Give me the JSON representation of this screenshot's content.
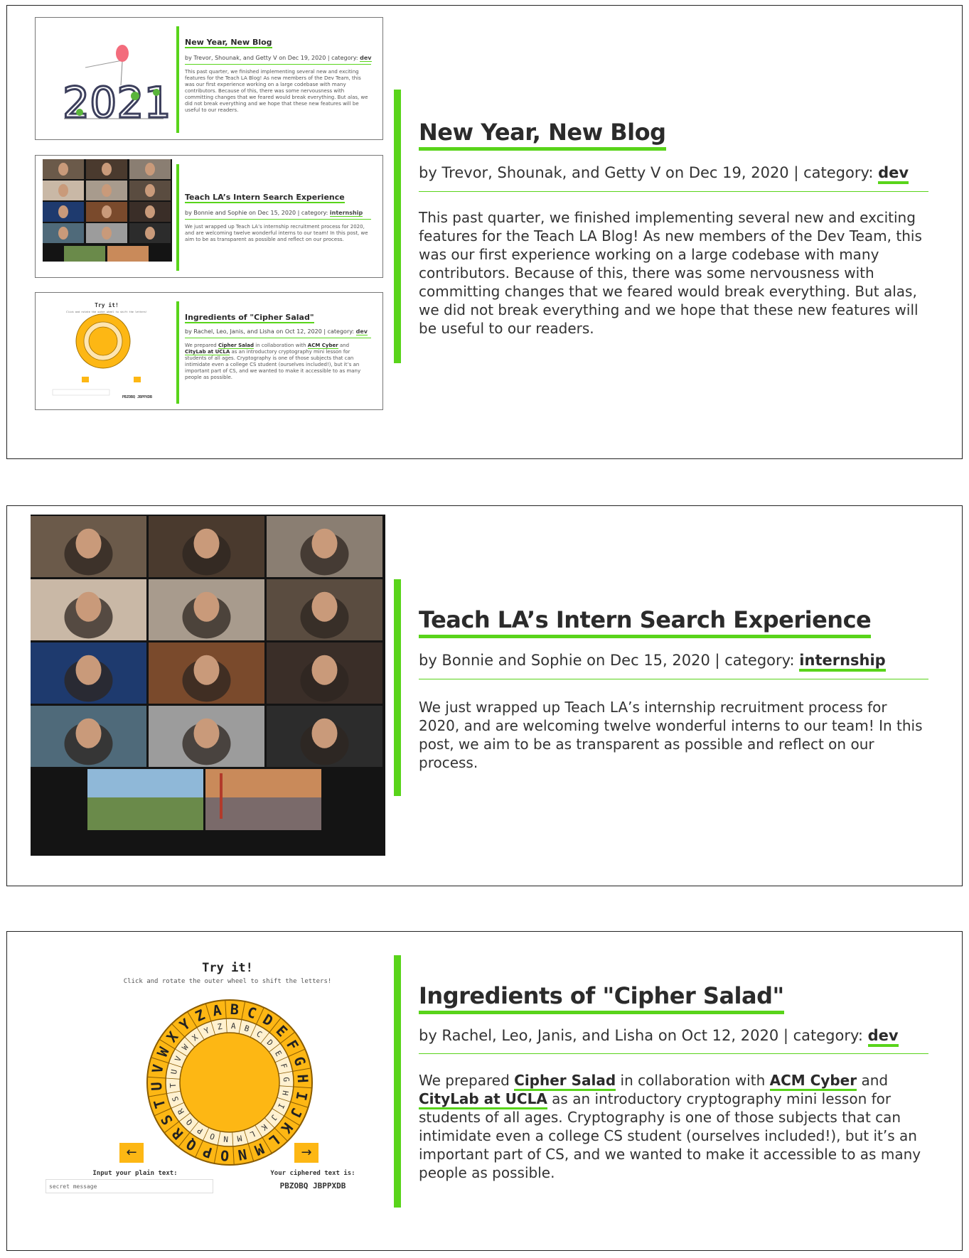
{
  "posts": [
    {
      "title": "New Year, New Blog",
      "byline_prefix": "by Trevor, Shounak, and Getty V on Dec 19, 2020 | category: ",
      "category": "dev",
      "body": "This past quarter, we finished implementing several new and exciting features for the Teach LA Blog! As new members of the Dev Team, this was our first experience working on a large codebase with many contributors. Because of this, there was some nervousness with committing changes that we feared would break everything. But alas, we did not break everything and we hope that these new features will be useful to our readers."
    },
    {
      "title": "Teach LA’s Intern Search Experience",
      "byline_prefix": "by Bonnie and Sophie on Dec 15, 2020 | category: ",
      "category": "internship",
      "body": "We just wrapped up Teach LA’s internship recruitment process for 2020, and are welcoming twelve wonderful interns to our team! In this post, we aim to be as transparent as possible and reflect on our process."
    },
    {
      "title": "Ingredients of \"Cipher Salad\"",
      "byline_prefix": "by Rachel, Leo, Janis, and Lisha on Oct 12, 2020 | category: ",
      "category": "dev",
      "body_parts": {
        "p1": "We prepared ",
        "link1": "Cipher Salad",
        "p2": " in collaboration with ",
        "link2": "ACM Cyber",
        "p3": " and ",
        "link3": "CityLab at UCLA",
        "p4": " as an introductory cryptography mini lesson for students of all ages. Cryptography is one of those subjects that can intimidate even a college CS student (ourselves included!), but it’s an important part of CS, and we wanted to make it accessible to as many people as possible."
      }
    }
  ],
  "thumbnails": {
    "year_image_text": "2021"
  },
  "cipher": {
    "heading": "Try it!",
    "instruction": "Click and rotate the outer wheel to shift the letters!",
    "outer_letters": "ABCDEFGHIJKLMNOPQRSTUVWXYZ",
    "inner_letters": "ZABCDEFGHIJKLMNOPQRSTUVWXY",
    "left_arrow": "←",
    "right_arrow": "→",
    "input_label": "Input your plain text:",
    "input_value": "secret message",
    "output_label": "Your ciphered text is:",
    "output_value": "PBZOBQ JBPPXDB"
  },
  "colors": {
    "accent_green": "#59d41a",
    "cipher_orange": "#fdb714",
    "zoom_background": "#141414"
  }
}
